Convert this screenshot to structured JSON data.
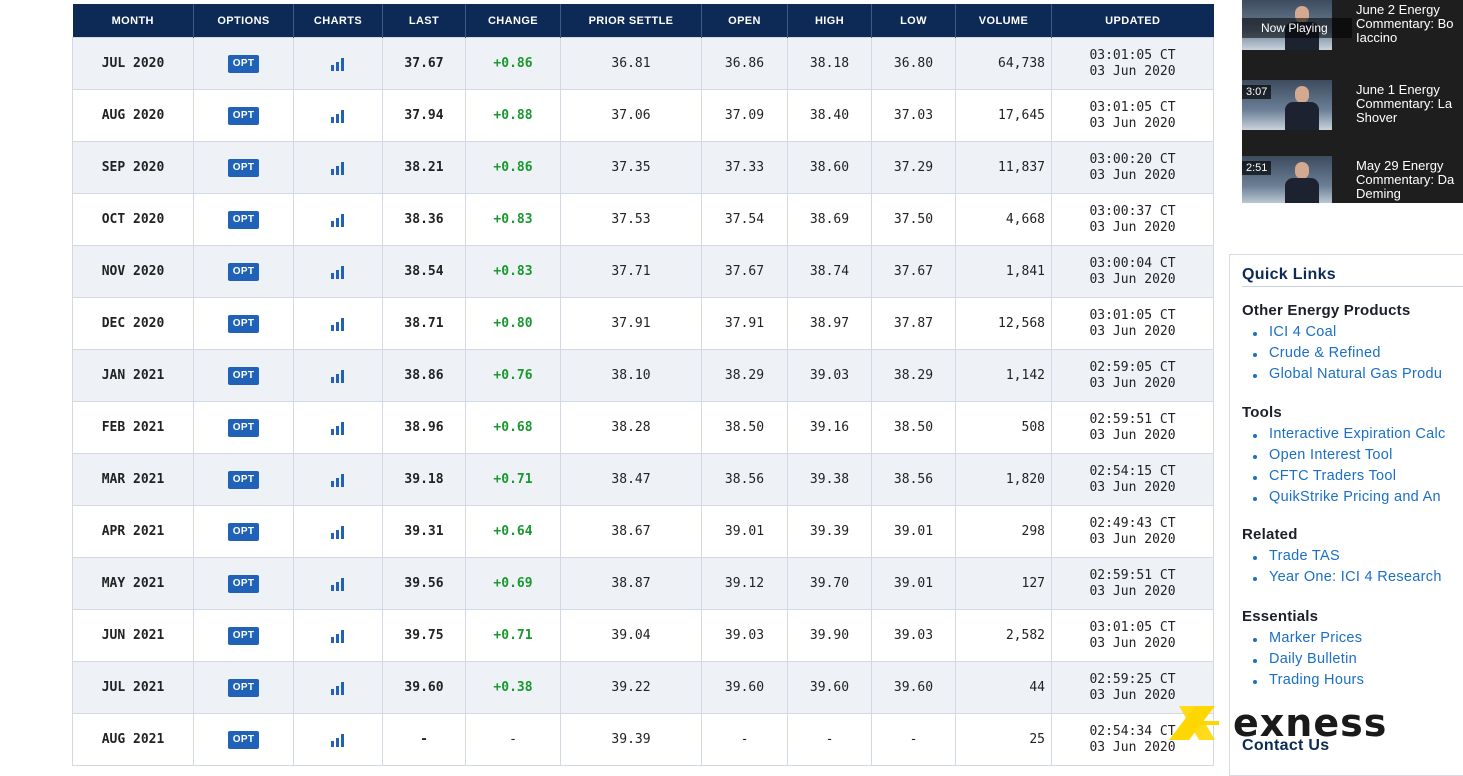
{
  "table": {
    "headers": [
      "MONTH",
      "OPTIONS",
      "CHARTS",
      "LAST",
      "CHANGE",
      "PRIOR SETTLE",
      "OPEN",
      "HIGH",
      "LOW",
      "VOLUME",
      "UPDATED"
    ],
    "opt_label": "OPT",
    "rows": [
      {
        "month": "JUL 2020",
        "last": "37.67",
        "change": "+0.86",
        "prior_settle": "36.81",
        "open": "36.86",
        "high": "38.18",
        "low": "36.80",
        "volume": "64,738",
        "updated_time": "03:01:05 CT",
        "updated_date": "03 Jun 2020"
      },
      {
        "month": "AUG 2020",
        "last": "37.94",
        "change": "+0.88",
        "prior_settle": "37.06",
        "open": "37.09",
        "high": "38.40",
        "low": "37.03",
        "volume": "17,645",
        "updated_time": "03:01:05 CT",
        "updated_date": "03 Jun 2020"
      },
      {
        "month": "SEP 2020",
        "last": "38.21",
        "change": "+0.86",
        "prior_settle": "37.35",
        "open": "37.33",
        "high": "38.60",
        "low": "37.29",
        "volume": "11,837",
        "updated_time": "03:00:20 CT",
        "updated_date": "03 Jun 2020"
      },
      {
        "month": "OCT 2020",
        "last": "38.36",
        "change": "+0.83",
        "prior_settle": "37.53",
        "open": "37.54",
        "high": "38.69",
        "low": "37.50",
        "volume": "4,668",
        "updated_time": "03:00:37 CT",
        "updated_date": "03 Jun 2020"
      },
      {
        "month": "NOV 2020",
        "last": "38.54",
        "change": "+0.83",
        "prior_settle": "37.71",
        "open": "37.67",
        "high": "38.74",
        "low": "37.67",
        "volume": "1,841",
        "updated_time": "03:00:04 CT",
        "updated_date": "03 Jun 2020"
      },
      {
        "month": "DEC 2020",
        "last": "38.71",
        "change": "+0.80",
        "prior_settle": "37.91",
        "open": "37.91",
        "high": "38.97",
        "low": "37.87",
        "volume": "12,568",
        "updated_time": "03:01:05 CT",
        "updated_date": "03 Jun 2020"
      },
      {
        "month": "JAN 2021",
        "last": "38.86",
        "change": "+0.76",
        "prior_settle": "38.10",
        "open": "38.29",
        "high": "39.03",
        "low": "38.29",
        "volume": "1,142",
        "updated_time": "02:59:05 CT",
        "updated_date": "03 Jun 2020"
      },
      {
        "month": "FEB 2021",
        "last": "38.96",
        "change": "+0.68",
        "prior_settle": "38.28",
        "open": "38.50",
        "high": "39.16",
        "low": "38.50",
        "volume": "508",
        "updated_time": "02:59:51 CT",
        "updated_date": "03 Jun 2020"
      },
      {
        "month": "MAR 2021",
        "last": "39.18",
        "change": "+0.71",
        "prior_settle": "38.47",
        "open": "38.56",
        "high": "39.38",
        "low": "38.56",
        "volume": "1,820",
        "updated_time": "02:54:15 CT",
        "updated_date": "03 Jun 2020"
      },
      {
        "month": "APR 2021",
        "last": "39.31",
        "change": "+0.64",
        "prior_settle": "38.67",
        "open": "39.01",
        "high": "39.39",
        "low": "39.01",
        "volume": "298",
        "updated_time": "02:49:43 CT",
        "updated_date": "03 Jun 2020"
      },
      {
        "month": "MAY 2021",
        "last": "39.56",
        "change": "+0.69",
        "prior_settle": "38.87",
        "open": "39.12",
        "high": "39.70",
        "low": "39.01",
        "volume": "127",
        "updated_time": "02:59:51 CT",
        "updated_date": "03 Jun 2020"
      },
      {
        "month": "JUN 2021",
        "last": "39.75",
        "change": "+0.71",
        "prior_settle": "39.04",
        "open": "39.03",
        "high": "39.90",
        "low": "39.03",
        "volume": "2,582",
        "updated_time": "03:01:05 CT",
        "updated_date": "03 Jun 2020"
      },
      {
        "month": "JUL 2021",
        "last": "39.60",
        "change": "+0.38",
        "prior_settle": "39.22",
        "open": "39.60",
        "high": "39.60",
        "low": "39.60",
        "volume": "44",
        "updated_time": "02:59:25 CT",
        "updated_date": "03 Jun 2020"
      },
      {
        "month": "AUG 2021",
        "last": "-",
        "change": "-",
        "prior_settle": "39.39",
        "open": "-",
        "high": "-",
        "low": "-",
        "volume": "25",
        "updated_time": "02:54:34 CT",
        "updated_date": "03 Jun 2020"
      }
    ]
  },
  "videos": [
    {
      "badge": "Now Playing",
      "title_lines": [
        "June 2 Energy",
        "Commentary: Bo",
        "Iaccino"
      ]
    },
    {
      "badge": "3:07",
      "title_lines": [
        "June 1 Energy",
        "Commentary: La",
        "Shover"
      ]
    },
    {
      "badge": "2:51",
      "title_lines": [
        "May 29 Energy",
        "Commentary: Da",
        "Deming"
      ]
    }
  ],
  "quick_links": {
    "title": "Quick Links",
    "sections": [
      {
        "heading": "Other Energy Products",
        "links": [
          "ICI 4 Coal",
          "Crude & Refined",
          "Global Natural Gas Produ"
        ]
      },
      {
        "heading": "Tools",
        "links": [
          "Interactive Expiration Calc",
          "Open Interest Tool",
          "CFTC Traders Tool",
          "QuikStrike Pricing and An"
        ]
      },
      {
        "heading": "Related",
        "links": [
          "Trade TAS",
          "Year One: ICI 4 Research"
        ]
      },
      {
        "heading": "Essentials",
        "links": [
          "Marker Prices",
          "Daily Bulletin",
          "Trading Hours"
        ]
      }
    ],
    "contact_us": "Contact Us"
  },
  "watermark": {
    "text": "exness"
  },
  "colors": {
    "header_bg": "#0c2a55",
    "opt_button": "#1f62b8",
    "positive_change": "#19982e",
    "link": "#1a6fc7",
    "watermark_yellow": "#ffd700"
  }
}
